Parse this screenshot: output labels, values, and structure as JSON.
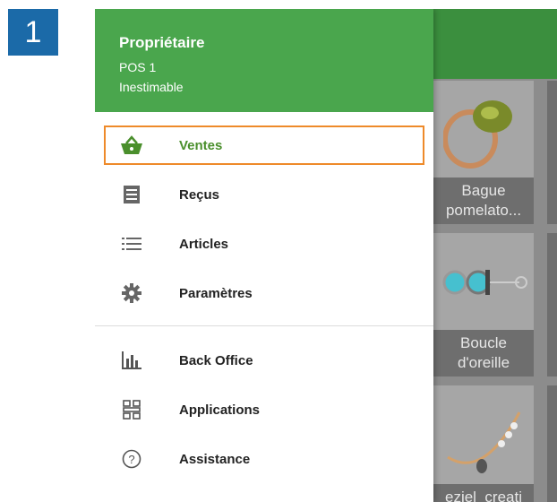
{
  "step_number": "1",
  "drawer": {
    "owner": "Propriétaire",
    "pos": "POS 1",
    "store": "Inestimable",
    "menu": [
      {
        "label": "Ventes",
        "icon": "basket-icon",
        "active": true
      },
      {
        "label": "Reçus",
        "icon": "receipt-icon"
      },
      {
        "label": "Articles",
        "icon": "list-icon"
      },
      {
        "label": "Paramètres",
        "icon": "gear-icon"
      }
    ],
    "menu_secondary": [
      {
        "label": "Back Office",
        "icon": "bar-chart-icon"
      },
      {
        "label": "Applications",
        "icon": "apps-icon"
      },
      {
        "label": "Assistance",
        "icon": "help-icon"
      }
    ]
  },
  "background_items": [
    {
      "caption_line1": "Bague",
      "caption_line2": "pomelato..."
    },
    {
      "caption_line1": "Boucle",
      "caption_line2": "d'oreille"
    },
    {
      "caption_line1": "",
      "caption_line2": "eziel_creati"
    }
  ],
  "colors": {
    "header_green": "#4aa64d",
    "topbar_green": "#3b8f3e",
    "active_green": "#4a8f2c",
    "highlight_orange": "#ee8a2a",
    "badge_blue": "#1b6aa8"
  }
}
